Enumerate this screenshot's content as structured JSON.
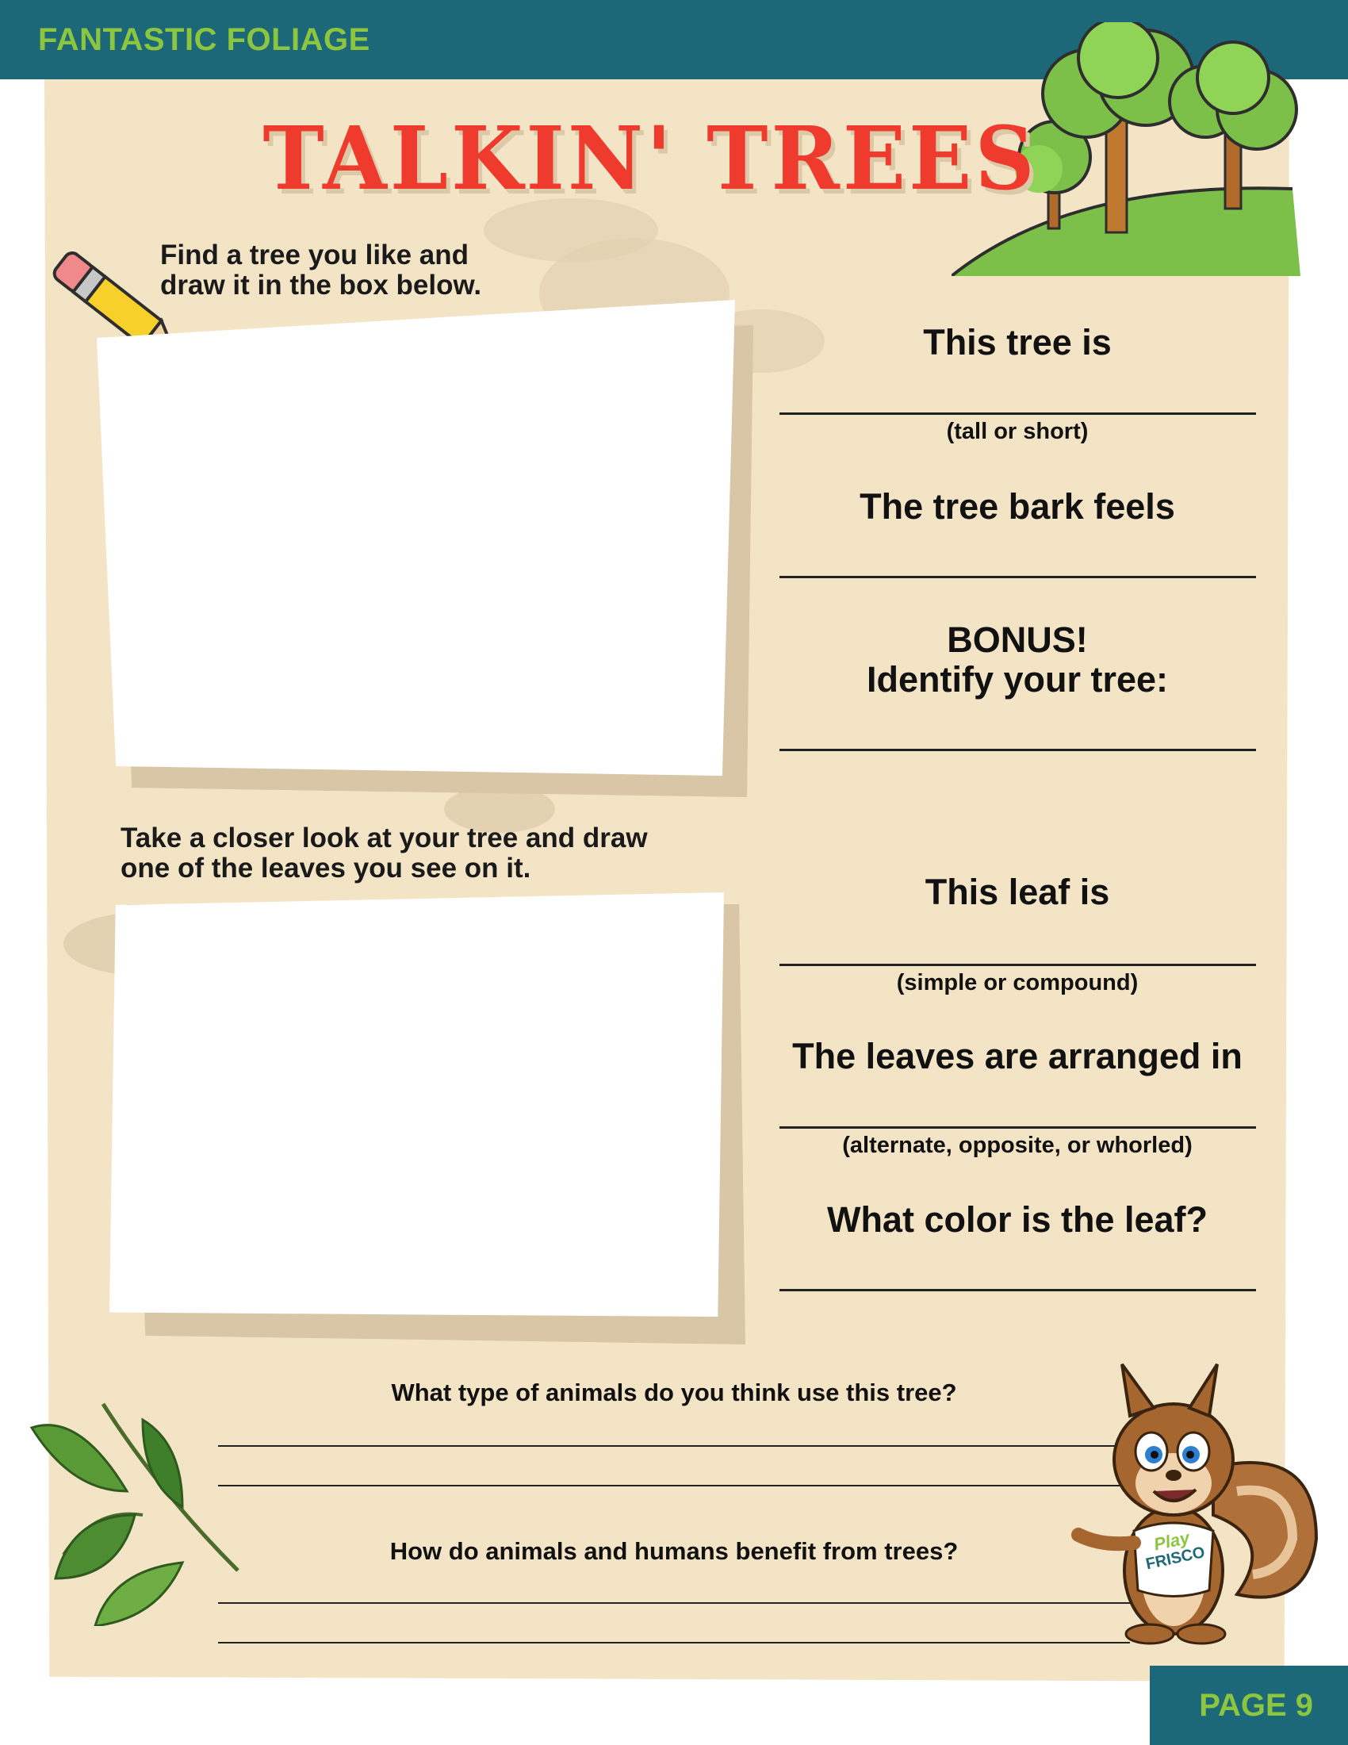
{
  "header": {
    "section_title": "FANTASTIC FOLIAGE"
  },
  "title": "TALKIN' TREES",
  "tree_section": {
    "prompt_line1": "Find a tree you like and",
    "prompt_line2": "draw it in the box below.",
    "questions": [
      {
        "label": "This tree is",
        "hint": "(tall or short)"
      },
      {
        "label": "The tree bark feels",
        "hint": ""
      },
      {
        "label_line1": "BONUS!",
        "label_line2": "Identify your tree:",
        "hint": ""
      }
    ]
  },
  "leaf_section": {
    "prompt_line1": "Take a closer look at your tree and draw",
    "prompt_line2": "one of the leaves you see on it.",
    "questions": [
      {
        "label": "This leaf is",
        "hint": "(simple or compound)"
      },
      {
        "label": "The leaves are arranged in",
        "hint": "(alternate, opposite, or whorled)"
      },
      {
        "label": "What color is the leaf?",
        "hint": ""
      }
    ]
  },
  "bottom_questions": [
    "What type of animals do you think use this tree?",
    "How do animals and humans benefit from trees?"
  ],
  "mascot": {
    "shirt_text_line1": "Play",
    "shirt_text_line2": "FRISCO"
  },
  "footer": {
    "page_label": "PAGE 9"
  },
  "colors": {
    "header": "#1d6878",
    "accent_green": "#8cc63f",
    "title_red": "#ee3b2d",
    "paper": "#f4e4c6"
  }
}
